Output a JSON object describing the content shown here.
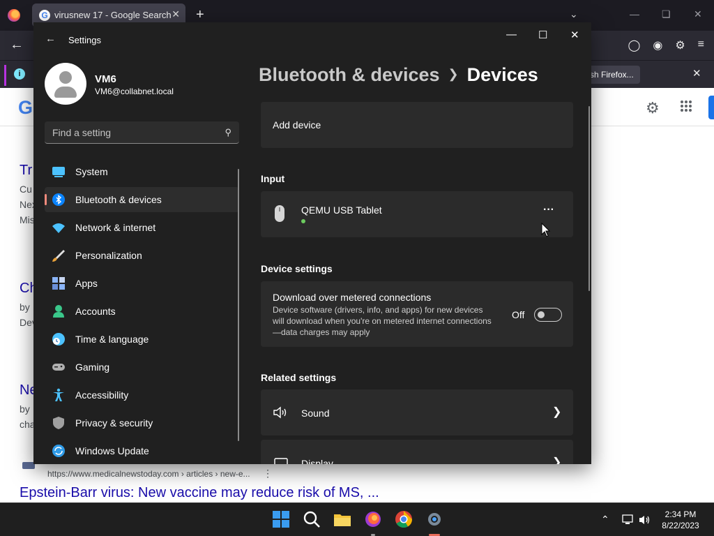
{
  "browser": {
    "tab_title": "virusnew 17 - Google Search",
    "notice_button": "sh Firefox..."
  },
  "google": {
    "logo_fragment": "G",
    "fragments": [
      {
        "text": "Tr",
        "kind": "link"
      },
      {
        "text": "Cu",
        "kind": "snip"
      },
      {
        "text": "Nex",
        "kind": "snip"
      },
      {
        "text": "Mis",
        "kind": "snip"
      },
      {
        "text": "Ch",
        "kind": "link"
      },
      {
        "text": "by",
        "kind": "snip"
      },
      {
        "text": "Dev",
        "kind": "snip"
      },
      {
        "text": "Ne",
        "kind": "link"
      },
      {
        "text": "by",
        "kind": "snip"
      },
      {
        "text": "cha",
        "kind": "snip"
      }
    ],
    "result_url": "https://www.medicalnewstoday.com › articles › new-e...",
    "result_title": "Epstein-Barr virus: New vaccine may reduce risk of MS, ..."
  },
  "settings": {
    "window_title": "Settings",
    "user": {
      "name": "VM6",
      "email": "VM6@collabnet.local"
    },
    "search_placeholder": "Find a setting",
    "nav": [
      {
        "label": "System",
        "icon": "system-icon",
        "color": "#4cc2ff"
      },
      {
        "label": "Bluetooth & devices",
        "icon": "bluetooth-icon",
        "color": "#0a84ff",
        "active": true
      },
      {
        "label": "Network & internet",
        "icon": "wifi-icon",
        "color": "#4cc2ff"
      },
      {
        "label": "Personalization",
        "icon": "brush-icon",
        "color": "#e9a23b"
      },
      {
        "label": "Apps",
        "icon": "apps-icon",
        "color": "#8ab4f8"
      },
      {
        "label": "Accounts",
        "icon": "accounts-icon",
        "color": "#3ac78a"
      },
      {
        "label": "Time & language",
        "icon": "globe-clock-icon",
        "color": "#4cc2ff"
      },
      {
        "label": "Gaming",
        "icon": "gamepad-icon",
        "color": "#b0b0b0"
      },
      {
        "label": "Accessibility",
        "icon": "accessibility-icon",
        "color": "#4cc2ff"
      },
      {
        "label": "Privacy & security",
        "icon": "shield-icon",
        "color": "#a0a0a0"
      },
      {
        "label": "Windows Update",
        "icon": "update-icon",
        "color": "#2f9be8"
      }
    ],
    "breadcrumb": {
      "parent": "Bluetooth & devices",
      "current": "Devices"
    },
    "add_device": "Add device",
    "input_header": "Input",
    "input_device": {
      "name": "QEMU USB Tablet",
      "more": "···"
    },
    "device_settings_header": "Device settings",
    "metered": {
      "title": "Download over metered connections",
      "description": "Device software (drivers, info, and apps) for new devices will download when you're on metered internet connections—data charges may apply",
      "toggle_label": "Off"
    },
    "related_header": "Related settings",
    "related": [
      {
        "label": "Sound",
        "icon": "speaker-icon"
      },
      {
        "label": "Display",
        "icon": "display-icon"
      }
    ]
  },
  "taskbar": {
    "time": "2:34 PM",
    "date": "8/22/2023"
  }
}
